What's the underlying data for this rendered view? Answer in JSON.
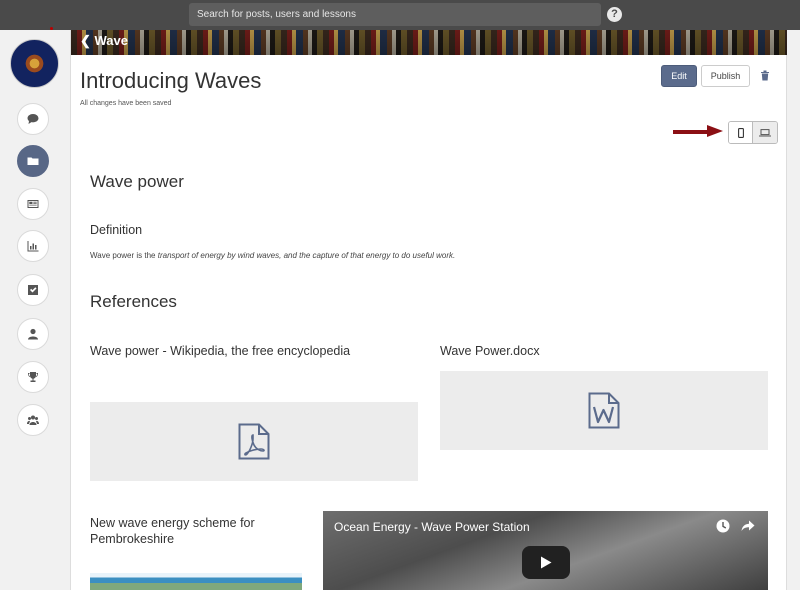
{
  "topbar": {
    "search_placeholder": "Search for posts, users and lessons",
    "help_label": "?"
  },
  "sidebar": {
    "items": [
      {
        "name": "chat",
        "icon": "chat-bubble-icon",
        "active": false
      },
      {
        "name": "folder",
        "icon": "folder-icon",
        "active": true
      },
      {
        "name": "news",
        "icon": "newspaper-icon",
        "active": false
      },
      {
        "name": "stats",
        "icon": "bar-chart-icon",
        "active": false
      },
      {
        "name": "tasks",
        "icon": "checkbox-icon",
        "active": false
      },
      {
        "name": "profile",
        "icon": "user-icon",
        "active": false
      },
      {
        "name": "trophy",
        "icon": "trophy-icon",
        "active": false
      },
      {
        "name": "groups",
        "icon": "group-icon",
        "active": false
      }
    ]
  },
  "header": {
    "back_label": "Wave",
    "title": "Introducing Waves",
    "save_status": "All changes have been saved",
    "edit_label": "Edit",
    "publish_label": "Publish"
  },
  "content": {
    "section1_title": "Wave power",
    "definition_heading": "Definition",
    "definition_prefix": "Wave power is the ",
    "definition_italic": "transport of energy by wind waves, and the capture of that energy to do useful work.",
    "references_title": "References",
    "ref1_title": "Wave power - Wikipedia, the free encyclopedia",
    "ref1_icon": "pdf-file-icon",
    "ref2_title": "Wave Power.docx",
    "ref2_icon": "word-file-icon",
    "ref3_title": "New wave energy scheme for Pembrokeshire",
    "video_title": "Ocean Energy - Wave Power Station"
  },
  "colors": {
    "accent": "#5b6b8c",
    "topbar": "#4a4a4a",
    "arrow": "#8b0f14"
  }
}
